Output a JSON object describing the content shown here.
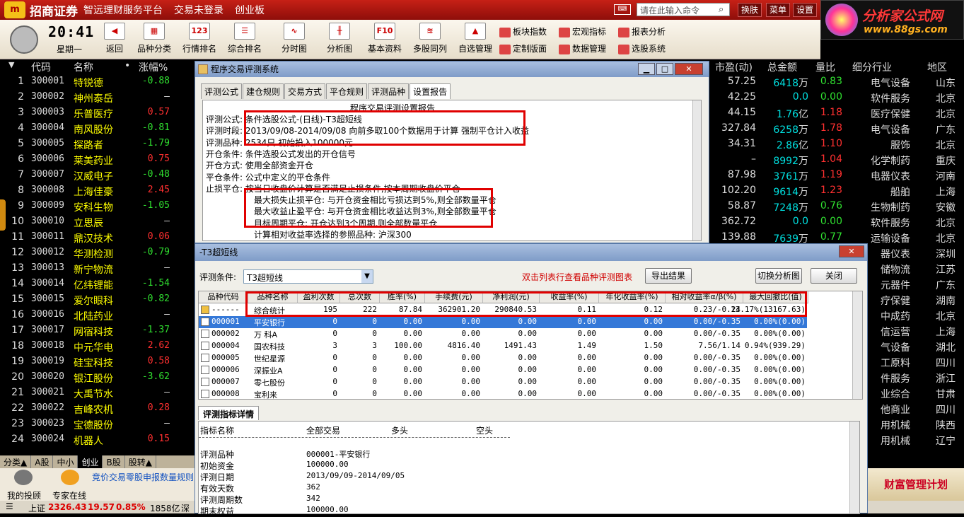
{
  "titlebar": {
    "brand": "招商证券",
    "tagline": "智远理财服务平台",
    "login_status": "交易未登录",
    "board": "创业板",
    "cmd_placeholder": "请在此输入命令",
    "btn_skin": "换肤",
    "btn_menu": "菜单",
    "btn_settings": "设置"
  },
  "ad": {
    "title": "分析家公式网",
    "url": "www.88gs.com"
  },
  "clock": {
    "time": "20:41",
    "weekday": "星期一"
  },
  "toolbar": {
    "tools": [
      {
        "label": "返回",
        "icon": "back-arrow-icon",
        "glyph": "◀"
      },
      {
        "label": "品种分类",
        "icon": "category-grid-icon",
        "glyph": "▦"
      },
      {
        "label": "行情排名",
        "icon": "ranking-icon",
        "glyph": "123"
      },
      {
        "label": "综合排名",
        "icon": "composite-rank-icon",
        "glyph": "☰"
      },
      {
        "label": "分时图",
        "icon": "intraday-chart-icon",
        "glyph": "∿"
      },
      {
        "label": "分析图",
        "icon": "candlestick-icon",
        "glyph": "╫"
      },
      {
        "label": "基本资料",
        "icon": "f10-icon",
        "glyph": "F10"
      },
      {
        "label": "多股同列",
        "icon": "multi-stock-icon",
        "glyph": "≋"
      },
      {
        "label": "自选管理",
        "icon": "watchlist-icon",
        "glyph": "▲"
      }
    ],
    "small_tools": [
      {
        "label": "板块指数",
        "icon": "sector-index-icon"
      },
      {
        "label": "宏观指标",
        "icon": "macro-indicator-icon"
      },
      {
        "label": "报表分析",
        "icon": "report-analysis-icon"
      },
      {
        "label": "定制版面",
        "icon": "custom-layout-icon"
      },
      {
        "label": "数据管理",
        "icon": "data-manage-icon"
      },
      {
        "label": "选股系统",
        "icon": "stock-picker-icon"
      }
    ]
  },
  "list": {
    "headers": {
      "code": "代码",
      "name": "名称",
      "dot": "•",
      "chg": "涨幅%",
      "pe": "市盈(动)",
      "amount": "总金额",
      "vr": "量比",
      "industry": "细分行业",
      "region": "地区"
    },
    "rows": [
      {
        "idx": "1",
        "code": "300001",
        "name": "特锐德",
        "chg": "-0.88"
      },
      {
        "idx": "2",
        "code": "300002",
        "name": "神州泰岳",
        "chg": "–"
      },
      {
        "idx": "3",
        "code": "300003",
        "name": "乐普医疗",
        "chg": "0.57"
      },
      {
        "idx": "4",
        "code": "300004",
        "name": "南风股份",
        "chg": "-0.81"
      },
      {
        "idx": "5",
        "code": "300005",
        "name": "探路者",
        "chg": "-1.79"
      },
      {
        "idx": "6",
        "code": "300006",
        "name": "莱美药业",
        "chg": "0.75"
      },
      {
        "idx": "7",
        "code": "300007",
        "name": "汉威电子",
        "chg": "-0.48"
      },
      {
        "idx": "8",
        "code": "300008",
        "name": "上海佳豪",
        "chg": "2.45"
      },
      {
        "idx": "9",
        "code": "300009",
        "name": "安科生物",
        "chg": "-1.05"
      },
      {
        "idx": "10",
        "code": "300010",
        "name": "立思辰",
        "chg": "–"
      },
      {
        "idx": "11",
        "code": "300011",
        "name": "鼎汉技术",
        "chg": "0.06"
      },
      {
        "idx": "12",
        "code": "300012",
        "name": "华测检测",
        "chg": "-0.79"
      },
      {
        "idx": "13",
        "code": "300013",
        "name": "新宁物流",
        "chg": "–"
      },
      {
        "idx": "14",
        "code": "300014",
        "name": "亿纬锂能",
        "chg": "-1.54"
      },
      {
        "idx": "15",
        "code": "300015",
        "name": "爱尔眼科",
        "chg": "-0.82"
      },
      {
        "idx": "16",
        "code": "300016",
        "name": "北陆药业",
        "chg": "–"
      },
      {
        "idx": "17",
        "code": "300017",
        "name": "网宿科技",
        "chg": "-1.37"
      },
      {
        "idx": "18",
        "code": "300018",
        "name": "中元华电",
        "chg": "2.62"
      },
      {
        "idx": "19",
        "code": "300019",
        "name": "硅宝科技",
        "chg": "0.58"
      },
      {
        "idx": "20",
        "code": "300020",
        "name": "银江股份",
        "chg": "-3.62"
      },
      {
        "idx": "21",
        "code": "300021",
        "name": "大禹节水",
        "chg": "–"
      },
      {
        "idx": "22",
        "code": "300022",
        "name": "吉峰农机",
        "chg": "0.28"
      },
      {
        "idx": "23",
        "code": "300023",
        "name": "宝德股份",
        "chg": "–"
      },
      {
        "idx": "24",
        "code": "300024",
        "name": "机器人",
        "chg": "0.15"
      }
    ],
    "right_rows": [
      {
        "pe": "57.25",
        "amt": "6418",
        "unit": "万",
        "vr": "0.83",
        "ind": "电气设备",
        "reg": "山东"
      },
      {
        "pe": "42.25",
        "amt": "0.0",
        "unit": "",
        "vr": "0.00",
        "ind": "软件服务",
        "reg": "北京"
      },
      {
        "pe": "44.15",
        "amt": "1.76",
        "unit": "亿",
        "vr": "1.18",
        "ind": "医疗保健",
        "reg": "北京"
      },
      {
        "pe": "327.84",
        "amt": "6258",
        "unit": "万",
        "vr": "1.78",
        "ind": "电气设备",
        "reg": "广东"
      },
      {
        "pe": "34.31",
        "amt": "2.86",
        "unit": "亿",
        "vr": "1.10",
        "ind": "服饰",
        "reg": "北京"
      },
      {
        "pe": "–",
        "amt": "8992",
        "unit": "万",
        "vr": "1.04",
        "ind": "化学制药",
        "reg": "重庆"
      },
      {
        "pe": "87.98",
        "amt": "3761",
        "unit": "万",
        "vr": "1.19",
        "ind": "电器仪表",
        "reg": "河南"
      },
      {
        "pe": "102.20",
        "amt": "9614",
        "unit": "万",
        "vr": "1.23",
        "ind": "船舶",
        "reg": "上海"
      },
      {
        "pe": "58.87",
        "amt": "7248",
        "unit": "万",
        "vr": "0.76",
        "ind": "生物制药",
        "reg": "安徽"
      },
      {
        "pe": "362.72",
        "amt": "0.0",
        "unit": "",
        "vr": "0.00",
        "ind": "软件服务",
        "reg": "北京"
      },
      {
        "pe": "139.88",
        "amt": "7639",
        "unit": "万",
        "vr": "0.77",
        "ind": "运输设备",
        "reg": "北京"
      },
      {
        "pe": "",
        "amt": "",
        "unit": "",
        "vr": "",
        "ind": "器仪表",
        "reg": "深圳"
      },
      {
        "pe": "",
        "amt": "",
        "unit": "",
        "vr": "",
        "ind": "储物流",
        "reg": "江苏"
      },
      {
        "pe": "",
        "amt": "",
        "unit": "",
        "vr": "",
        "ind": "元器件",
        "reg": "广东"
      },
      {
        "pe": "",
        "amt": "",
        "unit": "",
        "vr": "",
        "ind": "疗保健",
        "reg": "湖南"
      },
      {
        "pe": "",
        "amt": "",
        "unit": "",
        "vr": "",
        "ind": "中成药",
        "reg": "北京"
      },
      {
        "pe": "",
        "amt": "",
        "unit": "",
        "vr": "",
        "ind": "信运营",
        "reg": "上海"
      },
      {
        "pe": "",
        "amt": "",
        "unit": "",
        "vr": "",
        "ind": "气设备",
        "reg": "湖北"
      },
      {
        "pe": "",
        "amt": "",
        "unit": "",
        "vr": "",
        "ind": "工原料",
        "reg": "四川"
      },
      {
        "pe": "",
        "amt": "",
        "unit": "",
        "vr": "",
        "ind": "件服务",
        "reg": "浙江"
      },
      {
        "pe": "",
        "amt": "",
        "unit": "",
        "vr": "",
        "ind": "业综合",
        "reg": "甘肃"
      },
      {
        "pe": "",
        "amt": "",
        "unit": "",
        "vr": "",
        "ind": "他商业",
        "reg": "四川"
      },
      {
        "pe": "",
        "amt": "",
        "unit": "",
        "vr": "",
        "ind": "用机械",
        "reg": "陕西"
      },
      {
        "pe": "",
        "amt": "",
        "unit": "",
        "vr": "",
        "ind": "用机械",
        "reg": "辽宁"
      }
    ]
  },
  "bottom_tabs": [
    "分类▲",
    "A股",
    "中小",
    "创业",
    "B股",
    "股转▲"
  ],
  "bottom_panel": {
    "my_advice": "我的投顾",
    "expert": "专家在线",
    "ticker": "竞价交易零股申报数量规则"
  },
  "statusbar": {
    "index_name": "上证",
    "index_val": "2326.43",
    "index_chg": "19.57",
    "index_pct": "0.85%",
    "amount": "1858亿",
    "next": "深"
  },
  "ad_bottom": "财富管理计划",
  "win1": {
    "title": "程序交易评测系统",
    "tabs": [
      "评测公式",
      "建仓规则",
      "交易方式",
      "平仓规则",
      "评测品种",
      "设置报告"
    ],
    "active_tab": 5,
    "report_title": "程序交易评测设置报告",
    "lines": [
      "评测公式: 条件选股公式-(日线)-T3超短线",
      "评测时段: 2013/09/08-2014/09/08 向前多取100个数据用于计算 强制平仓计入收益",
      "评测品种: 2534只 初始投入100000元",
      "开仓条件: 条件选股公式发出的开仓信号",
      "开仓方式: 使用全部资金开仓",
      "平仓条件: 公式中定义的平仓条件",
      "止损平仓: 按当日收盘价计算是否满足止损条件,按本周期收盘价平仓",
      "最大损失止损平仓: 与开仓资金相比亏损达到5%,则全部数量平仓",
      "最大收益止盈平仓: 与开仓资金相比收益达到3%,则全部数量平仓",
      "目标周期平仓: 开仓达到3个周期,则全部数量平仓",
      "计算相对收益率选择的参照品种: 沪深300"
    ]
  },
  "win2": {
    "title": "-T3超短线",
    "cond_label": "评测条件:",
    "cond_value": "T3超短线",
    "hint": "双击列表行查看品种评测图表",
    "btn_export": "导出结果",
    "btn_switch": "切换分析图",
    "btn_close": "关闭",
    "columns": [
      "品种代码",
      "品种名称",
      "盈利次数",
      "总次数",
      "胜率(%)",
      "手续费(元)",
      "净利润(元)",
      "收益率(%)",
      "年化收益率(%)",
      "相对收益率α/β(%)",
      "最大回撤比(值)"
    ],
    "rows": [
      [
        "------",
        "综合统计",
        "195",
        "222",
        "87.84",
        "362901.20",
        "290840.53",
        "0.11",
        "0.12",
        "0.23/-0.24",
        "13.17%(13167.63)"
      ],
      [
        "000001",
        "平安银行",
        "0",
        "0",
        "0.00",
        "0.00",
        "0.00",
        "0.00",
        "0.00",
        "0.00/-0.35",
        "0.00%(0.00)"
      ],
      [
        "000002",
        "万 科A",
        "0",
        "0",
        "0.00",
        "0.00",
        "0.00",
        "0.00",
        "0.00",
        "0.00/-0.35",
        "0.00%(0.00)"
      ],
      [
        "000004",
        "国农科技",
        "3",
        "3",
        "100.00",
        "4816.40",
        "1491.43",
        "1.49",
        "1.50",
        "7.56/1.14",
        "0.94%(939.29)"
      ],
      [
        "000005",
        "世纪星源",
        "0",
        "0",
        "0.00",
        "0.00",
        "0.00",
        "0.00",
        "0.00",
        "0.00/-0.35",
        "0.00%(0.00)"
      ],
      [
        "000006",
        "深振业A",
        "0",
        "0",
        "0.00",
        "0.00",
        "0.00",
        "0.00",
        "0.00",
        "0.00/-0.35",
        "0.00%(0.00)"
      ],
      [
        "000007",
        "零七股份",
        "0",
        "0",
        "0.00",
        "0.00",
        "0.00",
        "0.00",
        "0.00",
        "0.00/-0.35",
        "0.00%(0.00)"
      ],
      [
        "000008",
        "宝利来",
        "0",
        "0",
        "0.00",
        "0.00",
        "0.00",
        "0.00",
        "0.00",
        "0.00/-0.35",
        "0.00%(0.00)"
      ]
    ],
    "selected_row": 1,
    "detail_tab": "评测指标详情",
    "detail_headers": [
      "指标名称",
      "全部交易",
      "多头",
      "空头"
    ],
    "detail_rows": [
      [
        "评测品种",
        "000001-平安银行"
      ],
      [
        "初始资金",
        "100000.00"
      ],
      [
        "评测日期",
        "2013/09/09-2014/09/05"
      ],
      [
        "有效天数",
        "362"
      ],
      [
        "评测周期数",
        "342"
      ],
      [
        "期末权益",
        "100000.00"
      ]
    ]
  },
  "colors": {
    "up": "#ff3030",
    "down": "#30e030",
    "accent": "#c62016",
    "highlight": "#e00000"
  }
}
